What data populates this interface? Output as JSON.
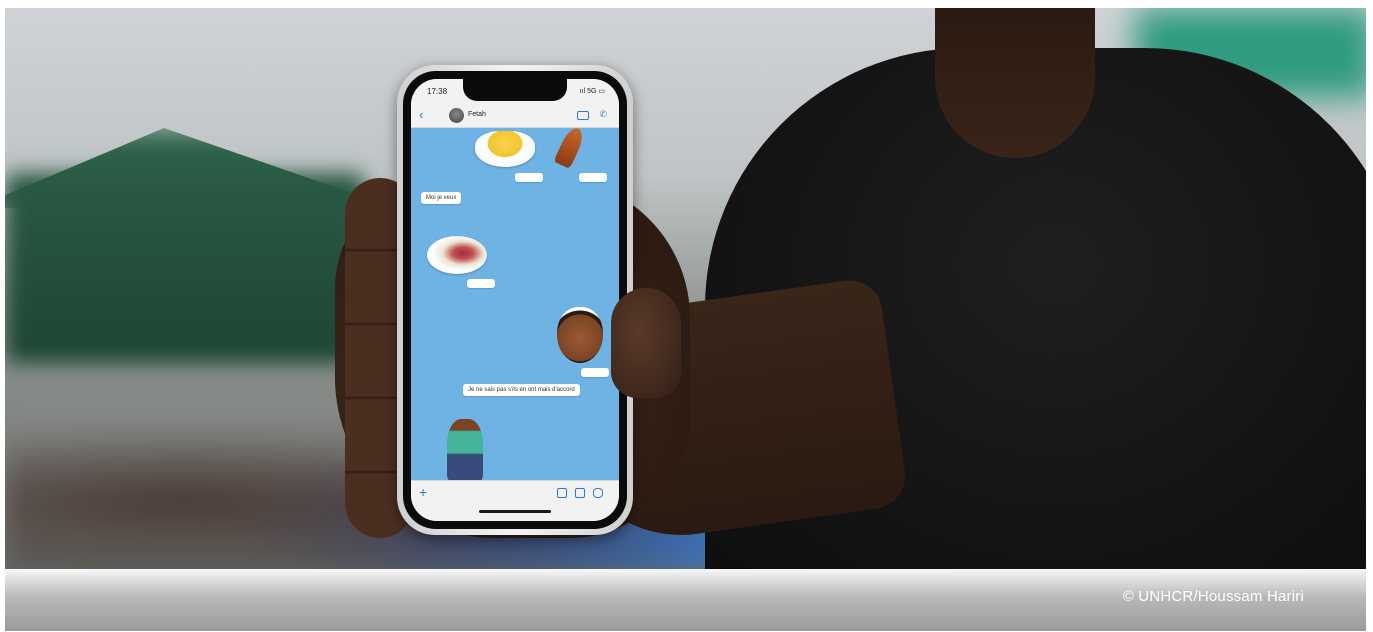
{
  "phone": {
    "status_time": "17:38",
    "status_icons": "ııl 5G ▭",
    "contact_name": "Fetah",
    "messages": [
      "Moi je veux",
      "Je ne sais pas s'ils en ont mais d'accord"
    ],
    "back_glyph": "‹",
    "call_glyph": "✆",
    "plus_glyph": "+"
  },
  "caption": {
    "credit": "© UNHCR/Houssam Hariri"
  },
  "colors": {
    "screen_background": "#6fb3e4",
    "accent": "#2a7ad6"
  }
}
